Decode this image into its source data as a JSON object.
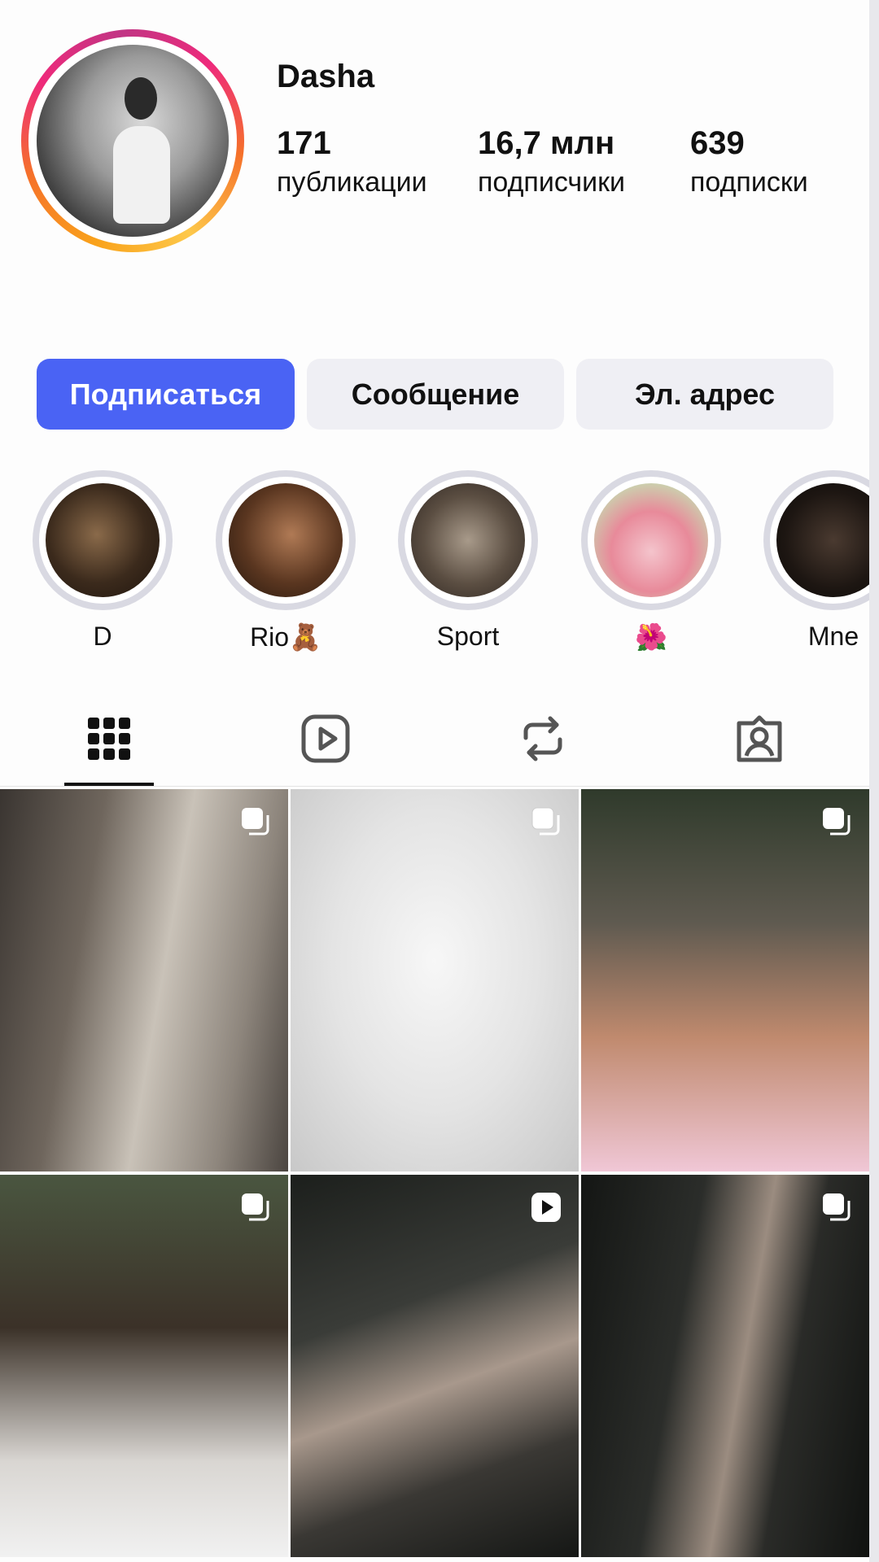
{
  "profile": {
    "username": "Dasha",
    "stats": [
      {
        "value": "171",
        "label": "публикации"
      },
      {
        "value": "16,7 млн",
        "label": "подписчики"
      },
      {
        "value": "639",
        "label": "подписки"
      }
    ]
  },
  "buttons": {
    "follow": "Подписаться",
    "message": "Сообщение",
    "email": "Эл. адрес"
  },
  "highlights": [
    {
      "label": "D"
    },
    {
      "label": "Rio🧸"
    },
    {
      "label": "Sport"
    },
    {
      "label": "🌺"
    },
    {
      "label": "Mne"
    }
  ],
  "tabs": [
    {
      "icon": "grid-icon",
      "active": true
    },
    {
      "icon": "reels-icon",
      "active": false
    },
    {
      "icon": "reposts-icon",
      "active": false
    },
    {
      "icon": "tagged-icon",
      "active": false
    }
  ],
  "posts": [
    {
      "type": "carousel"
    },
    {
      "type": "carousel"
    },
    {
      "type": "carousel"
    },
    {
      "type": "carousel"
    },
    {
      "type": "reel"
    },
    {
      "type": "carousel"
    }
  ],
  "colors": {
    "primary_button": "#4a63f4",
    "secondary_button": "#efeff4",
    "story_ring_start": "#f9a21b",
    "story_ring_end": "#c13584"
  }
}
